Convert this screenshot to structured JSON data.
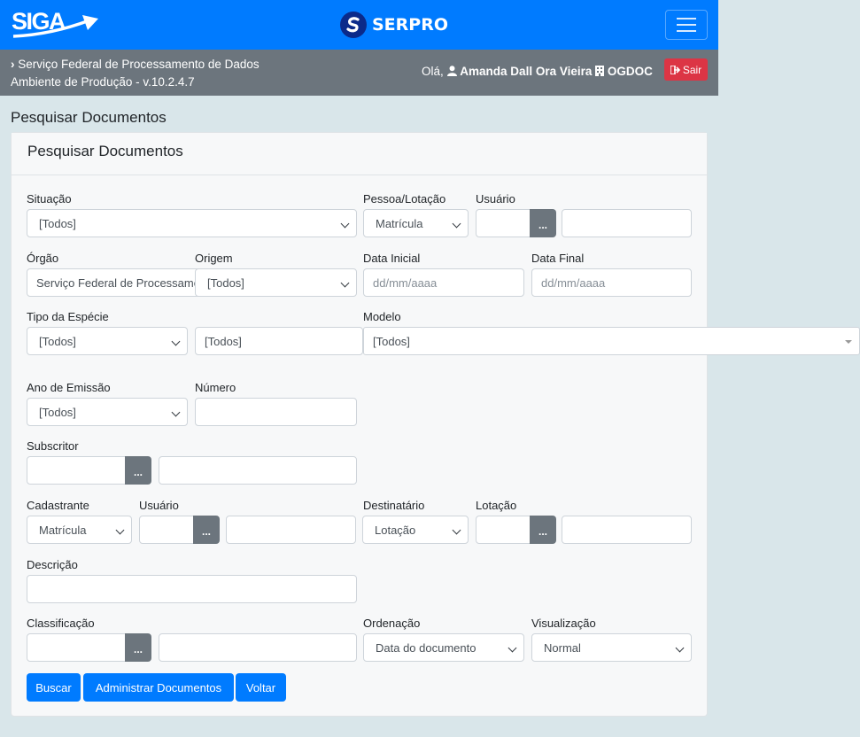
{
  "brand": {
    "siga": "SIGA",
    "serpro": "SERPRO"
  },
  "info": {
    "org_line": "Serviço Federal de Processamento de Dados",
    "env_line": "Ambiente de Produção - v.10.2.4.7",
    "greeting": "Olá,",
    "user_name": "Amanda Dall Ora Vieira",
    "unit": "OGDOC",
    "logout": "Sair"
  },
  "page_title": "Pesquisar Documentos",
  "card_title": "Pesquisar Documentos",
  "labels": {
    "situacao": "Situação",
    "pessoa_lotacao": "Pessoa/Lotação",
    "usuario": "Usuário",
    "orgao": "Órgão",
    "origem": "Origem",
    "data_inicial": "Data Inicial",
    "data_final": "Data Final",
    "tipo_especie": "Tipo da Espécie",
    "modelo": "Modelo",
    "ano_emissao": "Ano de Emissão",
    "numero": "Número",
    "subscritor": "Subscritor",
    "cadastrante": "Cadastrante",
    "usuario2": "Usuário",
    "destinatario": "Destinatário",
    "lotacao": "Lotação",
    "descricao": "Descrição",
    "classificacao": "Classificação",
    "ordenacao": "Ordenação",
    "visualizacao": "Visualização"
  },
  "values": {
    "situacao": "[Todos]",
    "pessoa_lotacao": "Matrícula",
    "orgao": "Serviço Federal de Processamento de Dados",
    "origem": "[Todos]",
    "data_inicial_ph": "dd/mm/aaaa",
    "data_final_ph": "dd/mm/aaaa",
    "tipo_especie": "[Todos]",
    "especie": "[Todos]",
    "modelo": "[Todos]",
    "ano_emissao": "[Todos]",
    "cadastrante": "Matrícula",
    "destinatario": "Lotação",
    "ordenacao": "Data do documento",
    "visualizacao": "Normal",
    "dots": "..."
  },
  "buttons": {
    "buscar": "Buscar",
    "administrar": "Administrar Documentos",
    "voltar": "Voltar"
  },
  "colors": {
    "primary": "#007bff",
    "secondary": "#6c757d",
    "danger": "#dc3545",
    "background": "#d9e6ea"
  }
}
